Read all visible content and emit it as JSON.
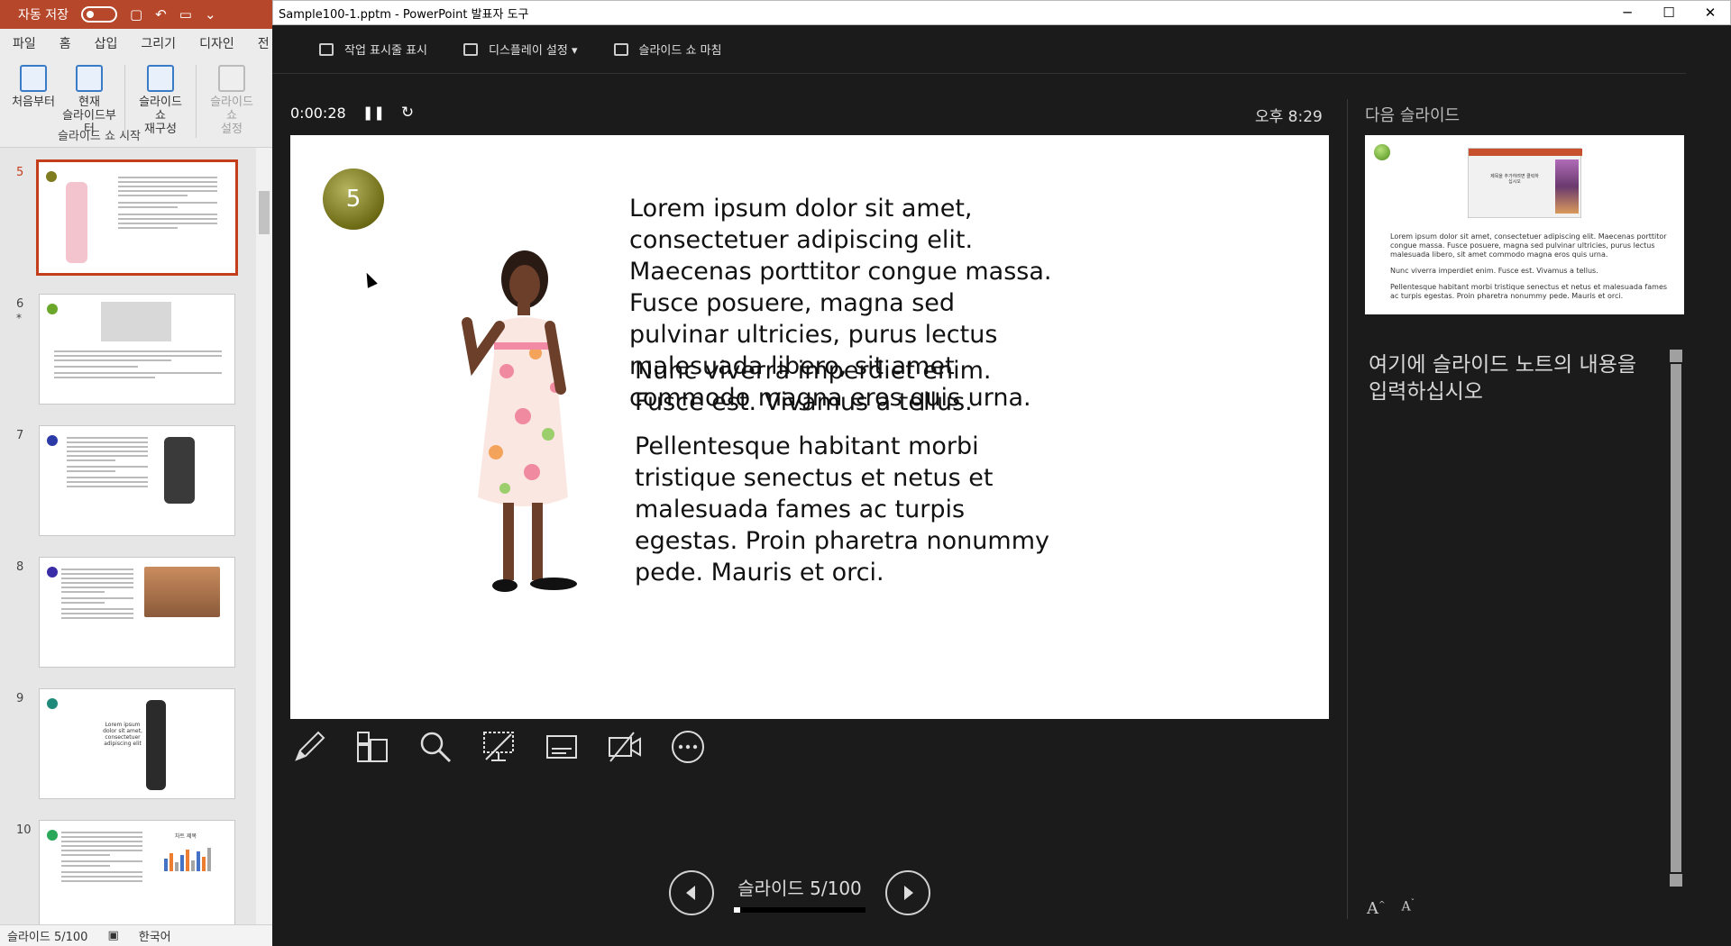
{
  "ppt": {
    "autosave_label": "자동 저장",
    "tabs": [
      "파일",
      "홈",
      "삽입",
      "그리기",
      "디자인",
      "전"
    ],
    "ribbon": {
      "from_start": "처음부터",
      "from_current_1": "현재",
      "from_current_2": "슬라이드부터",
      "custom_1": "슬라이드 쇼",
      "custom_2": "재구성",
      "setup_1": "슬라이드 쇼",
      "setup_2": "설정",
      "group_label": "슬라이드 쇼 시작"
    },
    "thumbnails": [
      {
        "num": "5",
        "selected": true
      },
      {
        "num": "6",
        "star": "*"
      },
      {
        "num": "7"
      },
      {
        "num": "8"
      },
      {
        "num": "9"
      },
      {
        "num": "10"
      }
    ],
    "thumb_9_text": "Lorem ipsum dolor sit amet, consectetuer adipiscing elit",
    "thumb_10_chart_title": "차트 제목",
    "status": {
      "slide": "슬라이드 5/100",
      "language": "한국어"
    }
  },
  "presenter": {
    "window_title": "Sample100-1.pptm - PowerPoint 발표자 도구",
    "toolbar": {
      "taskbar": "작업 표시줄 표시",
      "display": "디스플레이 설정 ▾",
      "end_show": "슬라이드 쇼 마침"
    },
    "timer": "0:00:28",
    "clock": "오후 8:29",
    "slide": {
      "number": "5",
      "para1": "Lorem ipsum dolor sit amet, consectetuer adipiscing elit. Maecenas porttitor congue massa. Fusce posuere, magna sed pulvinar ultricies, purus lectus malesuada libero, sit amet commodo magna eros quis urna.",
      "para2": "Nunc viverra imperdiet enim. Fusce est. Vivamus a tellus.",
      "para3": "Pellentesque habitant morbi tristique senectus et netus et malesuada fames ac turpis egestas. Proin pharetra nonummy pede. Mauris et orci."
    },
    "next_slide_label": "다음 슬라이드",
    "next_slide": {
      "mini_title": "제목을 추가하려면 클릭하십시오",
      "para1": "Lorem ipsum dolor sit amet, consectetuer adipiscing elit. Maecenas porttitor congue massa. Fusce posuere, magna sed pulvinar ultricies, purus lectus malesuada libero, sit amet commodo magna eros quis urna.",
      "para2": "Nunc viverra imperdiet enim. Fusce est. Vivamus a tellus.",
      "para3": "Pellentesque habitant morbi tristique senectus et netus et malesuada fames ac turpis egestas. Proin pharetra nonummy pede. Mauris et orci."
    },
    "notes_placeholder": "여기에 슬라이드 노트의 내용을 입력하십시오",
    "counter": "슬라이드 5/100",
    "progress": 0.05
  },
  "colors": {
    "ppt_accent": "#b7472a",
    "selection": "#c43e1c",
    "presenter_bg": "#1b1b1b"
  },
  "icons": [
    "pen-icon",
    "see-all-slides-icon",
    "zoom-icon",
    "black-screen-icon",
    "subtitles-icon",
    "camera-off-icon",
    "more-options-icon"
  ]
}
